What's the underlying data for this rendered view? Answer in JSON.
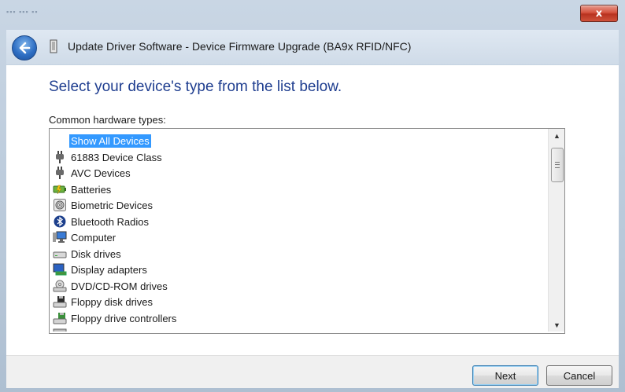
{
  "window": {
    "title": "Update Driver Software - Device Firmware Upgrade (BA9x RFID/NFC)",
    "close_label": "x"
  },
  "main": {
    "instruction": "Select your device's type from the list below.",
    "list_label": "Common hardware types:"
  },
  "hardware_types": [
    {
      "label": "Show All Devices",
      "icon": "none",
      "selected": true
    },
    {
      "label": "61883 Device Class",
      "icon": "plug-icon",
      "selected": false
    },
    {
      "label": "AVC Devices",
      "icon": "plug-icon",
      "selected": false
    },
    {
      "label": "Batteries",
      "icon": "battery-icon",
      "selected": false
    },
    {
      "label": "Biometric Devices",
      "icon": "fingerprint-icon",
      "selected": false
    },
    {
      "label": "Bluetooth Radios",
      "icon": "bluetooth-icon",
      "selected": false
    },
    {
      "label": "Computer",
      "icon": "computer-icon",
      "selected": false
    },
    {
      "label": "Disk drives",
      "icon": "disk-drive-icon",
      "selected": false
    },
    {
      "label": "Display adapters",
      "icon": "display-adapter-icon",
      "selected": false
    },
    {
      "label": "DVD/CD-ROM drives",
      "icon": "dvd-drive-icon",
      "selected": false
    },
    {
      "label": "Floppy disk drives",
      "icon": "floppy-drive-icon",
      "selected": false
    },
    {
      "label": "Floppy drive controllers",
      "icon": "floppy-controller-icon",
      "selected": false
    }
  ],
  "buttons": {
    "next": "Next",
    "cancel": "Cancel"
  },
  "colors": {
    "selection": "#3399ff",
    "instruction_text": "#1e3d8f"
  }
}
